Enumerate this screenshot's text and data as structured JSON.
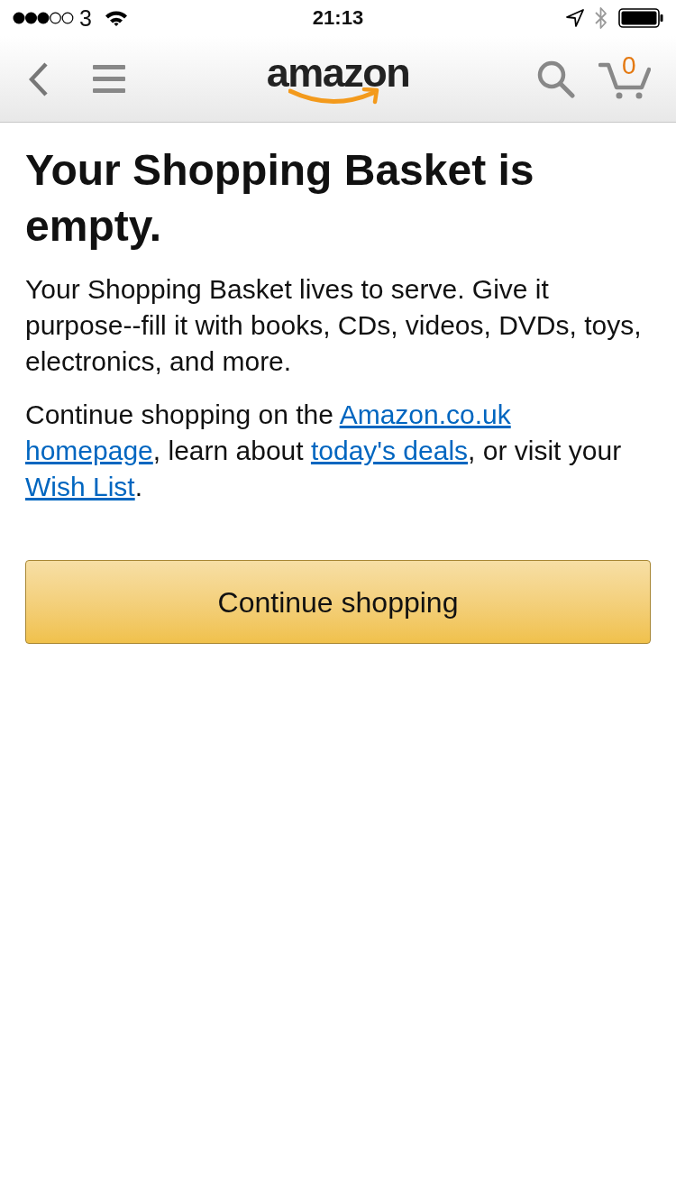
{
  "status_bar": {
    "carrier": "3",
    "time": "21:13"
  },
  "nav_bar": {
    "logo": "amazon",
    "cart_count": "0"
  },
  "heading": "Your Shopping Basket is empty.",
  "intro": "Your Shopping Basket lives to serve. Give it purpose--fill it with books, CDs, videos, DVDs, toys, electronics, and more.",
  "links_paragraph": [
    {
      "kind": "text",
      "text": "Continue shopping on the "
    },
    {
      "kind": "link",
      "text": "Amazon.co.uk"
    },
    {
      "kind": "link",
      "text": "homepage"
    },
    {
      "kind": "text",
      "text": ", learn about "
    },
    {
      "kind": "link",
      "text": "today's deals"
    },
    {
      "kind": "text",
      "text": ", or visit your "
    },
    {
      "kind": "link",
      "text": "Wish List"
    },
    {
      "kind": "text",
      "text": "."
    }
  ],
  "primary_button": {
    "label": "Continue shopping"
  }
}
